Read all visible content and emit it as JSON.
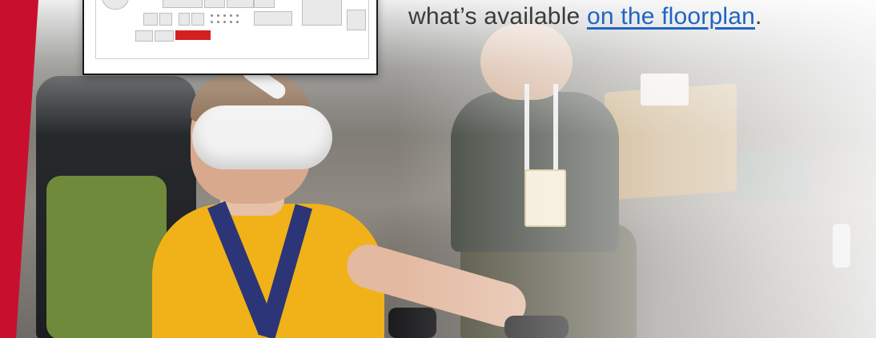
{
  "text": {
    "sentence_start": "what’s available ",
    "floorplan_link": "on the floorplan",
    "sentence_end": "."
  },
  "colors": {
    "brand_red": "#c8102e",
    "link_blue": "#1f63c6",
    "shirt_yellow": "#f0b218"
  },
  "icons": {
    "floorplan_thumbnail": "floorplan-map-icon"
  }
}
